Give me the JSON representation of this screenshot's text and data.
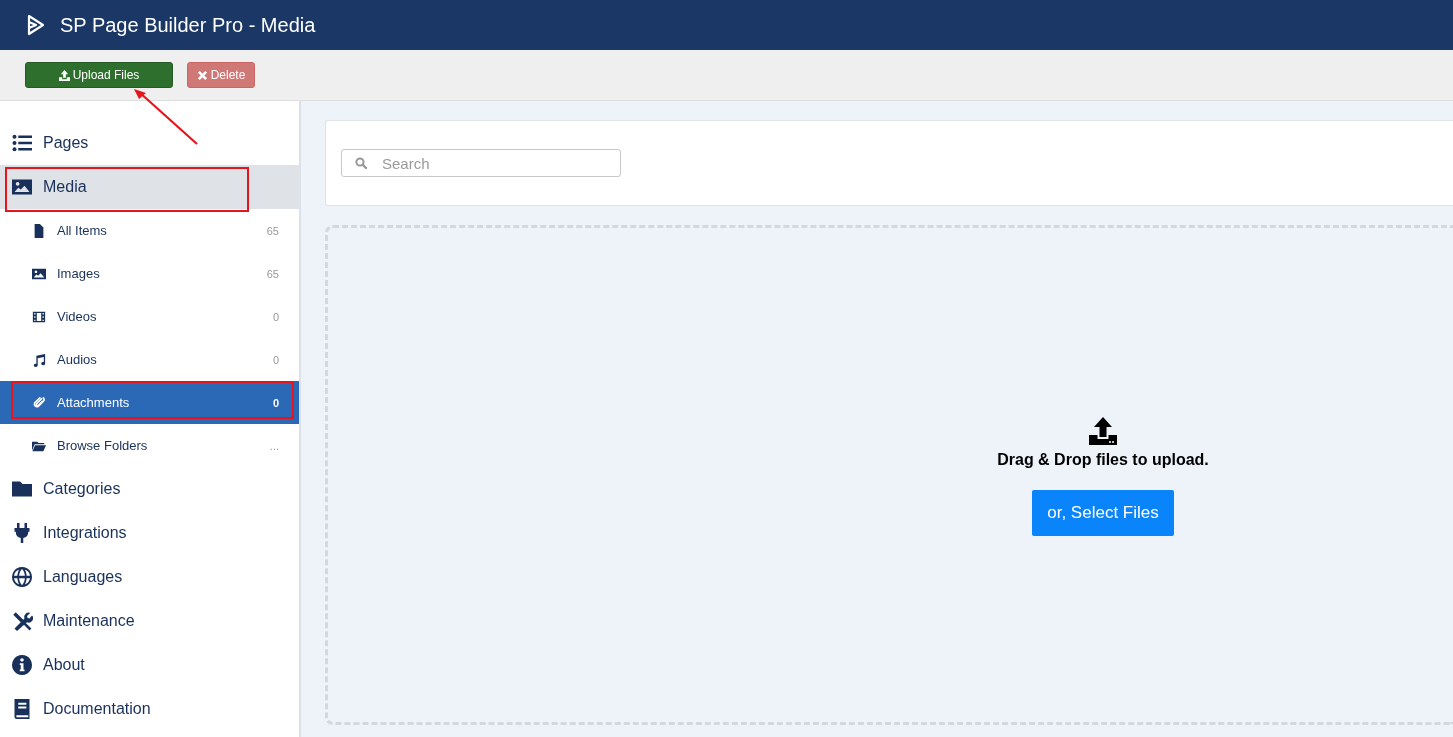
{
  "header": {
    "title": "SP Page Builder Pro - Media"
  },
  "toolbar": {
    "buttons": [
      {
        "kind": "upload",
        "label": "Upload Files"
      },
      {
        "kind": "delete",
        "label": "Delete"
      }
    ]
  },
  "annotations": [
    {
      "kind": "arrow"
    }
  ],
  "sidebar": {
    "items": [
      {
        "kind": "list",
        "label": "Pages",
        "selected": false,
        "highlighted": false
      },
      {
        "kind": "image",
        "label": "Media",
        "selected": true,
        "highlighted": true,
        "children": [
          {
            "kind": "file",
            "label": "All Items",
            "count": "65",
            "selected": false,
            "highlighted": false
          },
          {
            "kind": "image",
            "label": "Images",
            "count": "65",
            "selected": false,
            "highlighted": false
          },
          {
            "kind": "film",
            "label": "Videos",
            "count": "0",
            "selected": false,
            "highlighted": false
          },
          {
            "kind": "music",
            "label": "Audios",
            "count": "0",
            "selected": false,
            "highlighted": false
          },
          {
            "kind": "clip",
            "label": "Attachments",
            "count": "0",
            "selected": true,
            "highlighted": true
          },
          {
            "kind": "folder-open",
            "label": "Browse Folders",
            "count": "...",
            "selected": false,
            "highlighted": false
          }
        ]
      },
      {
        "kind": "folder",
        "label": "Categories",
        "selected": false,
        "highlighted": false
      },
      {
        "kind": "plug",
        "label": "Integrations",
        "selected": false,
        "highlighted": false
      },
      {
        "kind": "globe",
        "label": "Languages",
        "selected": false,
        "highlighted": false
      },
      {
        "kind": "tools",
        "label": "Maintenance",
        "selected": false,
        "highlighted": false
      },
      {
        "kind": "info",
        "label": "About",
        "selected": false,
        "highlighted": false
      },
      {
        "kind": "book",
        "label": "Documentation",
        "selected": false,
        "highlighted": false
      }
    ]
  },
  "search": {
    "placeholder": "Search"
  },
  "dropzone": {
    "message": "Drag & Drop files to upload.",
    "button": "or, Select Files"
  }
}
